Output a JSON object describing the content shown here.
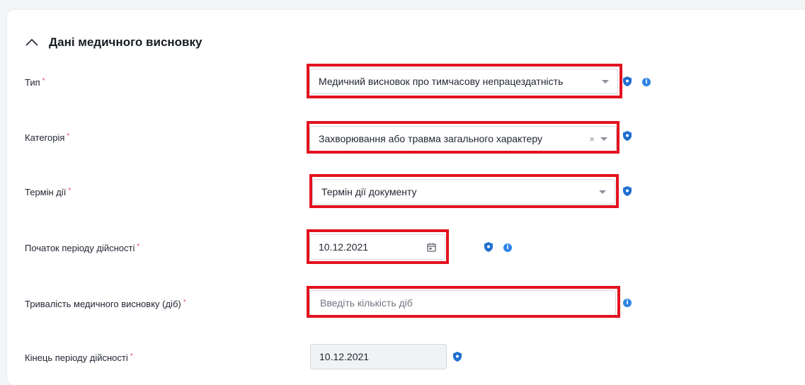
{
  "section": {
    "title": "Дані медичного висновку",
    "collapse_icon": "chevron-up-icon"
  },
  "required_mark": "*",
  "fields": {
    "type": {
      "label": "Тип",
      "value": "Медичний висновок про тимчасову непрацездатність",
      "icons": [
        "shield-icon",
        "info-icon"
      ]
    },
    "category": {
      "label": "Категорія",
      "value": "Захворювання або травма загального характеру",
      "clear_glyph": "×",
      "icons": [
        "shield-icon"
      ]
    },
    "validity_term": {
      "label": "Термін дії",
      "value": "Термін дії документу",
      "icons": [
        "shield-icon"
      ]
    },
    "period_start": {
      "label": "Початок періоду дійсності",
      "value": "10.12.2021",
      "icons": [
        "calendar-icon",
        "shield-icon",
        "info-icon"
      ]
    },
    "duration": {
      "label": "Тривалість медичного висновку (діб)",
      "value": "",
      "placeholder": "Введіть кількість діб",
      "icons": [
        "info-icon"
      ]
    },
    "period_end": {
      "label": "Кінець періоду дійсності",
      "value": "10.12.2021",
      "icons": [
        "shield-icon"
      ]
    }
  },
  "info_glyph": "i",
  "colors": {
    "highlight": "#e3121f",
    "required": "#e34b5b",
    "shield": "#1f6fd1",
    "info": "#2f84e6"
  }
}
